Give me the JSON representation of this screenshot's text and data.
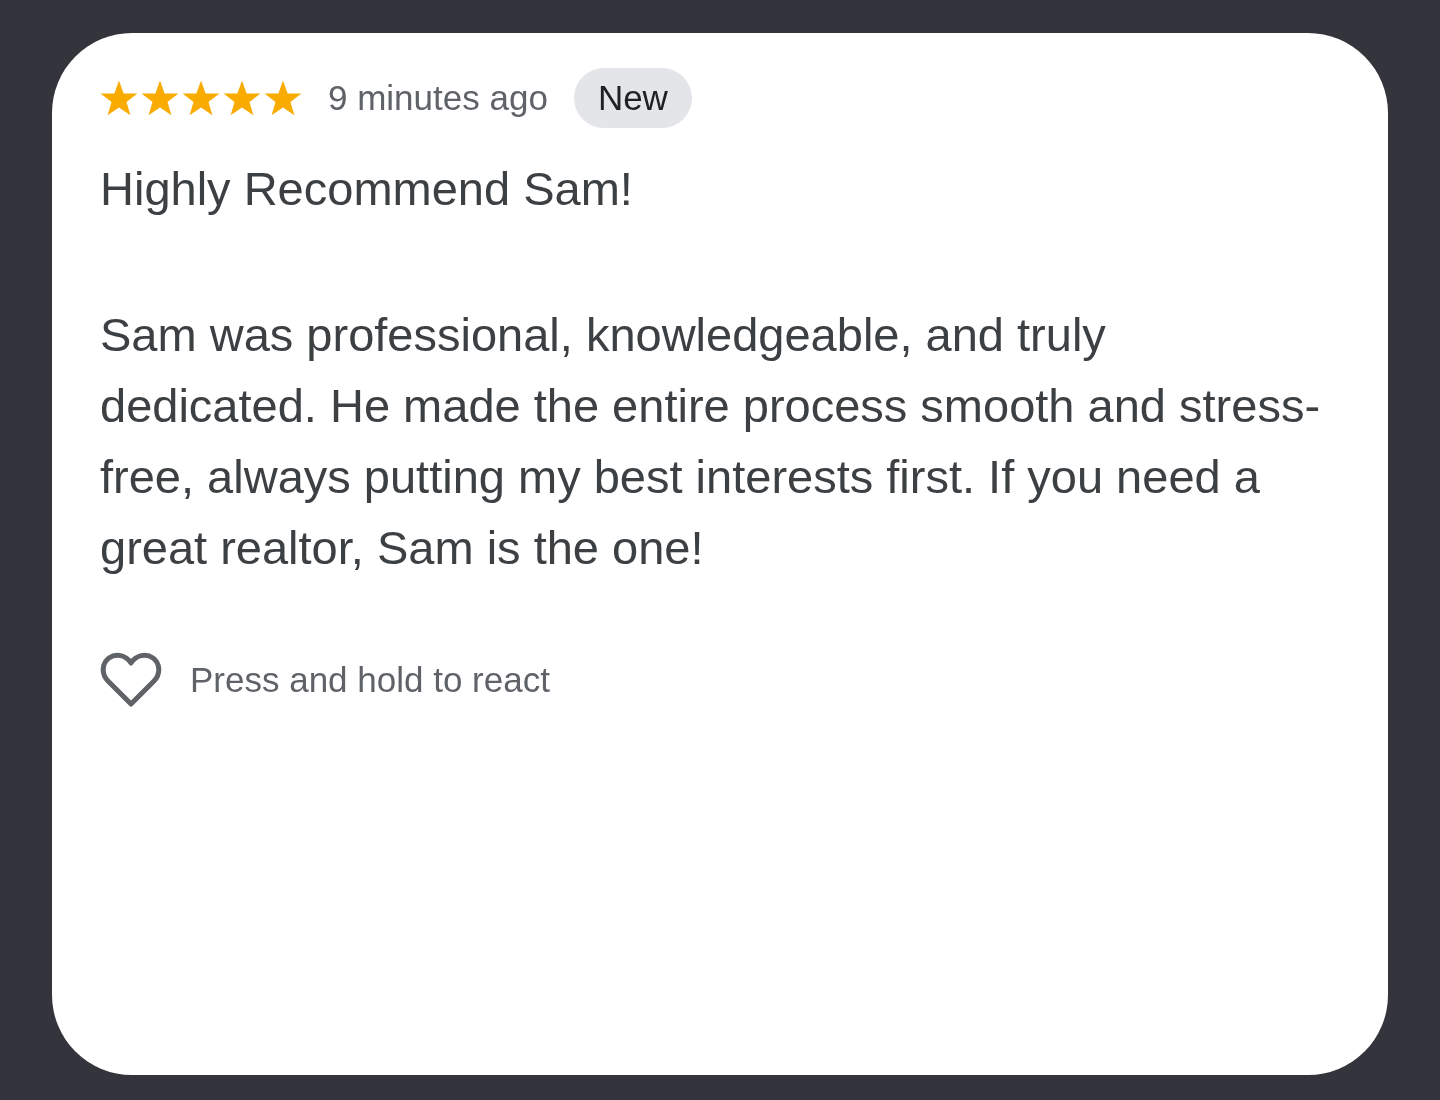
{
  "review": {
    "stars": 5,
    "time": "9 minutes ago",
    "badge": "New",
    "title": "Highly Recommend Sam!",
    "body": "Sam was professional, knowledgeable, and truly dedicated. He made the entire process smooth and stress-free, always putting my best interests first. If you need a great realtor, Sam is the one!",
    "reaction": {
      "label": "Press and hold to react"
    }
  }
}
